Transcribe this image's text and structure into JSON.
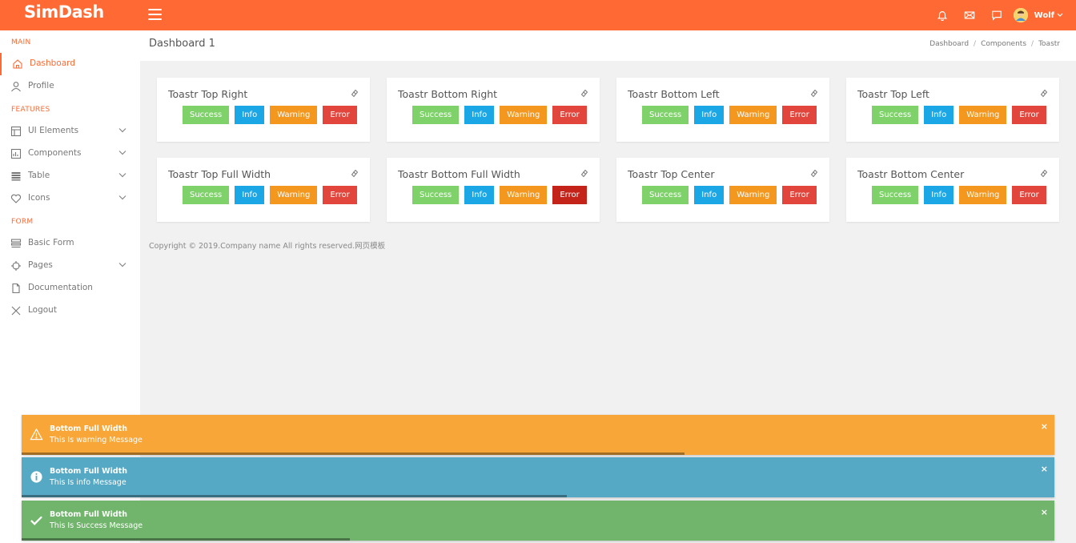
{
  "brand": {
    "logo_text": "SimDash",
    "accent": "#ff6a34"
  },
  "topbar": {
    "username": "Wolf"
  },
  "sidebar": {
    "sections": [
      "MAIN",
      "FEATURES",
      "FORM"
    ],
    "items": [
      {
        "label": "Dashboard",
        "icon": "home-icon"
      },
      {
        "label": "Profile",
        "icon": "user-icon"
      },
      {
        "label": "UI Elements",
        "icon": "layout-icon"
      },
      {
        "label": "Components",
        "icon": "chart-icon"
      },
      {
        "label": "Table",
        "icon": "table-icon"
      },
      {
        "label": "Icons",
        "icon": "heart-icon"
      },
      {
        "label": "Basic Form",
        "icon": "form-icon"
      },
      {
        "label": "Pages",
        "icon": "target-icon"
      },
      {
        "label": "Documentation",
        "icon": "document-icon"
      },
      {
        "label": "Logout",
        "icon": "close-icon"
      }
    ]
  },
  "header": {
    "title": "Dashboard 1",
    "breadcrumb": [
      "Dashboard",
      "Components",
      "Toastr"
    ]
  },
  "buttons": {
    "success": "Success",
    "info": "Info",
    "warning": "Warning",
    "error": "Error"
  },
  "cards": [
    {
      "title": "Toastr Top Right"
    },
    {
      "title": "Toastr Bottom Right"
    },
    {
      "title": "Toastr Bottom Left"
    },
    {
      "title": "Toastr Top Left"
    },
    {
      "title": "Toastr Top Full Width"
    },
    {
      "title": "Toastr Bottom Full Width"
    },
    {
      "title": "Toastr Top Center"
    },
    {
      "title": "Toastr Bottom Center"
    }
  ],
  "footer": {
    "copyright": "Copyright © 2019.Company name All rights reserved.网页模板"
  },
  "toasts": [
    {
      "type": "warning",
      "title": "Bottom Full Width",
      "message": "This Is warning Message",
      "progress": 0.642,
      "close": "×"
    },
    {
      "type": "info",
      "title": "Bottom Full Width",
      "message": "This Is info Message",
      "progress": 0.528,
      "close": "×"
    },
    {
      "type": "success",
      "title": "Bottom Full Width",
      "message": "This Is Success Message",
      "progress": 0.318,
      "close": "×"
    }
  ]
}
